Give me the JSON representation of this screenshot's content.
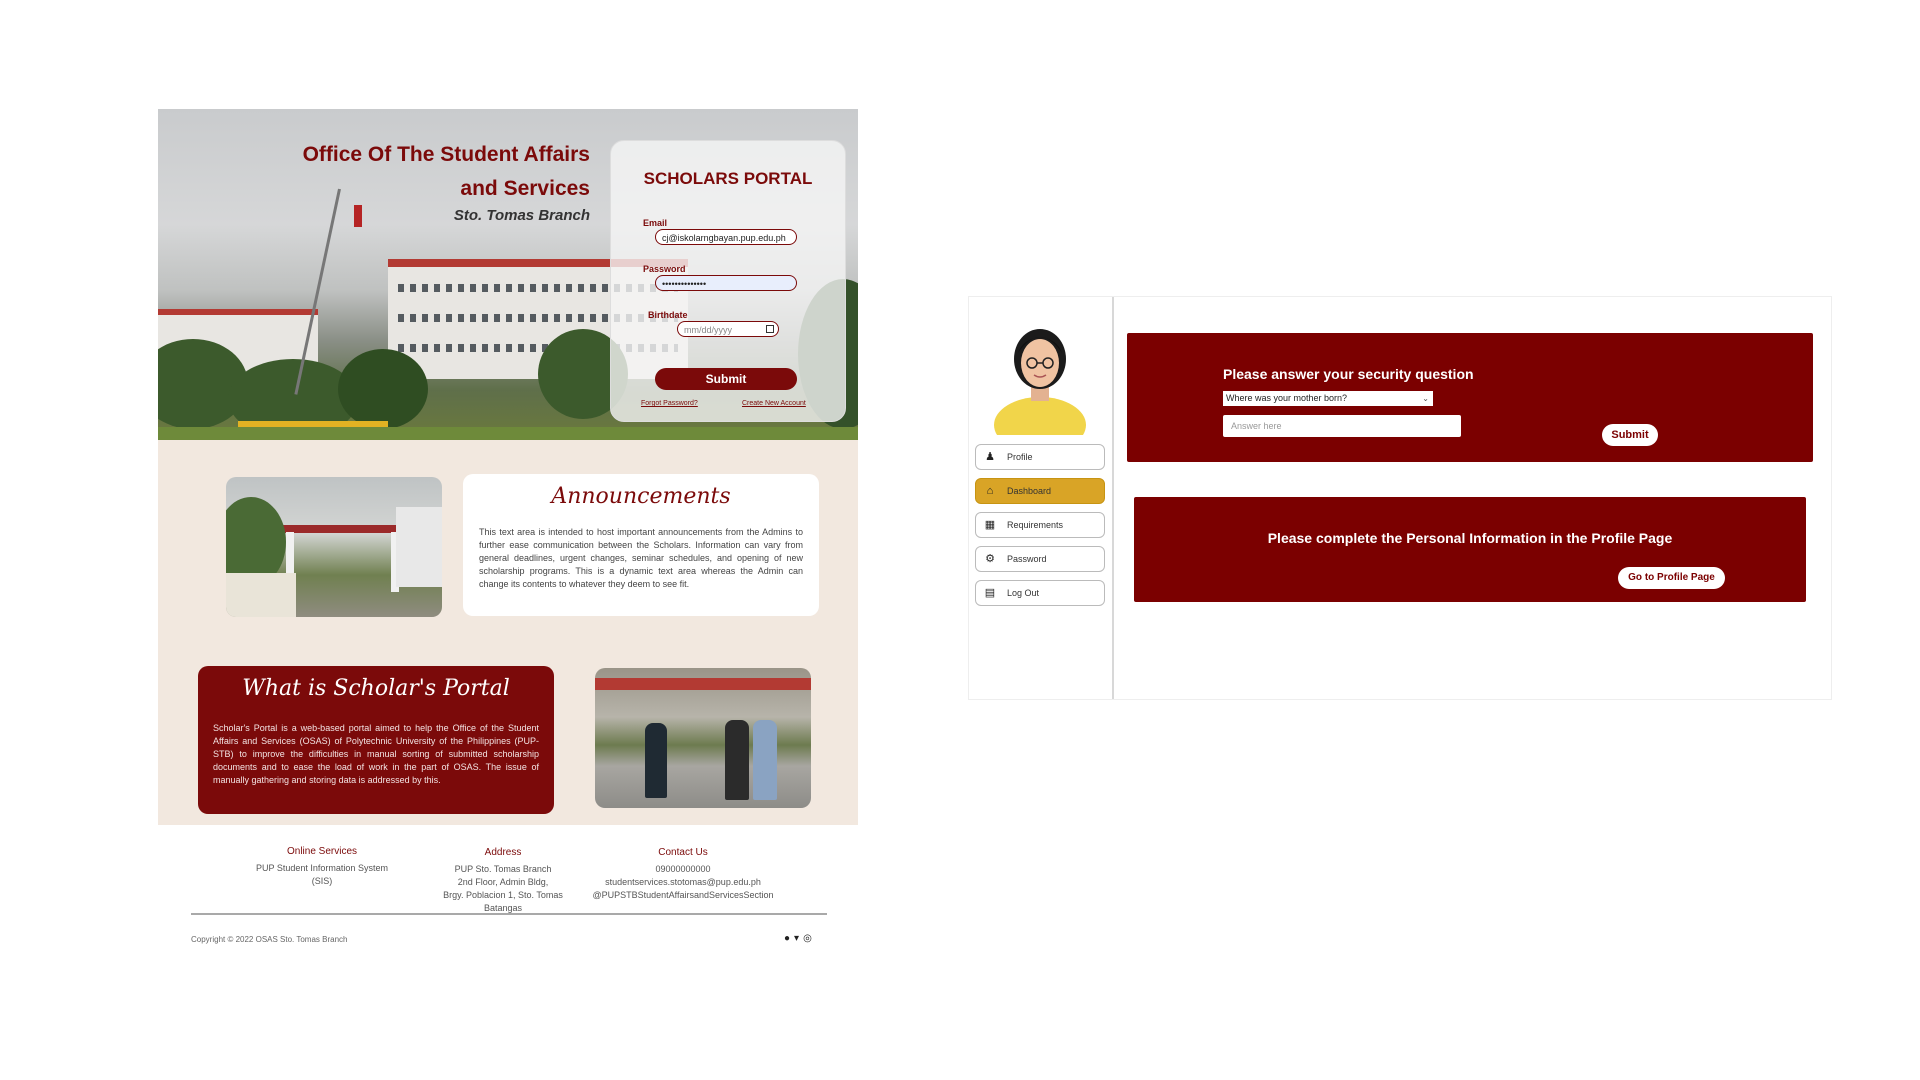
{
  "login_page": {
    "hero": {
      "title_line1": "Office Of The Student Affairs",
      "title_line2": "and Services",
      "subtitle": "Sto. Tomas Branch"
    },
    "login_card": {
      "title": "SCHOLARS PORTAL",
      "email_label": "Email",
      "email_value": "cj@iskolarngbayan.pup.edu.ph",
      "password_label": "Password",
      "password_value": "••••••••••••••",
      "birthdate_label": "Birthdate",
      "birthdate_placeholder": "mm/dd/yyyy",
      "submit_label": "Submit",
      "forgot_password": "Forgot Password?",
      "create_account": "Create New Account"
    },
    "announcements": {
      "title": "Announcements",
      "body": "This text area is intended to host important announcements from the Admins to further ease communication between the Scholars. Information can vary from general deadlines, urgent changes, seminar schedules, and opening of new scholarship programs. This is a dynamic text area whereas the Admin can change its contents to whatever they deem to see fit."
    },
    "about": {
      "title": "What is Scholar's Portal",
      "body": "Scholar's Portal is a web-based portal aimed to help the Office of the Student Affairs and Services (OSAS) of Polytechnic University of the Philippines (PUP-STB) to improve the difficulties in manual sorting of submitted scholarship documents and to ease the load of work in the part of OSAS. The issue of manually gathering and storing data is addressed by this."
    },
    "footer": {
      "online_services_heading": "Online Services",
      "online_services_item": "PUP Student Information System (SIS)",
      "address_heading": "Address",
      "address_lines": [
        "PUP Sto. Tomas Branch",
        "2nd Floor, Admin Bldg,",
        "Brgy. Poblacion 1, Sto. Tomas",
        "Batangas"
      ],
      "contact_heading": "Contact Us",
      "contact_lines": [
        "09000000000",
        "studentservices.stotomas@pup.edu.ph",
        "@PUPSTBStudentAffairsandServicesSection"
      ],
      "copyright": "Copyright © 2022 OSAS Sto. Tomas Branch",
      "social_icons": [
        "facebook-icon",
        "twitter-icon",
        "instagram-icon"
      ]
    }
  },
  "dashboard_page": {
    "nav": [
      {
        "label": "Profile",
        "icon": "user-icon"
      },
      {
        "label": "Dashboard",
        "icon": "home-icon",
        "active": true
      },
      {
        "label": "Requirements",
        "icon": "documents-icon"
      },
      {
        "label": "Password",
        "icon": "gears-icon"
      },
      {
        "label": "Log Out",
        "icon": "door-icon"
      }
    ],
    "security": {
      "title": "Please answer your security question",
      "selected_question": "Where was your mother born?",
      "answer_placeholder": "Answer here",
      "submit_label": "Submit"
    },
    "profile_notice": {
      "title": "Please complete the Personal Information in the Profile Page",
      "button_label": "Go to Profile Page"
    }
  },
  "colors": {
    "maroon": "#7b0a0a",
    "panel_maroon": "#7b0000",
    "active_nav": "#d9a426",
    "cream": "#f2e8df"
  }
}
